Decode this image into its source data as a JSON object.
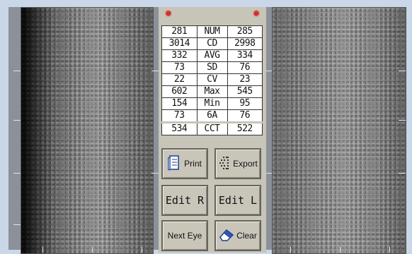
{
  "markers": {
    "left": "✹",
    "right": "✹"
  },
  "stats": [
    {
      "right": "281",
      "label": "NUM",
      "left": "285"
    },
    {
      "right": "3014",
      "label": "CD",
      "left": "2998"
    },
    {
      "right": "332",
      "label": "AVG",
      "left": "334"
    },
    {
      "right": "73",
      "label": "SD",
      "left": "76"
    },
    {
      "right": "22",
      "label": "CV",
      "left": "23"
    },
    {
      "right": "602",
      "label": "Max",
      "left": "545"
    },
    {
      "right": "154",
      "label": "Min",
      "left": "95"
    },
    {
      "right": "73",
      "label": "6A",
      "left": "76"
    },
    {
      "right": "534",
      "label": "CCT",
      "left": "522"
    }
  ],
  "buttons": {
    "print": "Print",
    "export": "Export",
    "edit_r": "Edit R",
    "edit_l": "Edit L",
    "next_eye": "Next Eye",
    "clear": "Clear"
  },
  "icons": {
    "print": "printer-icon",
    "export": "export-icon",
    "clear": "eraser-icon"
  },
  "colors": {
    "panel": "#c7c4b8",
    "marker": "#d3312c",
    "background": "#c9d7e8"
  }
}
